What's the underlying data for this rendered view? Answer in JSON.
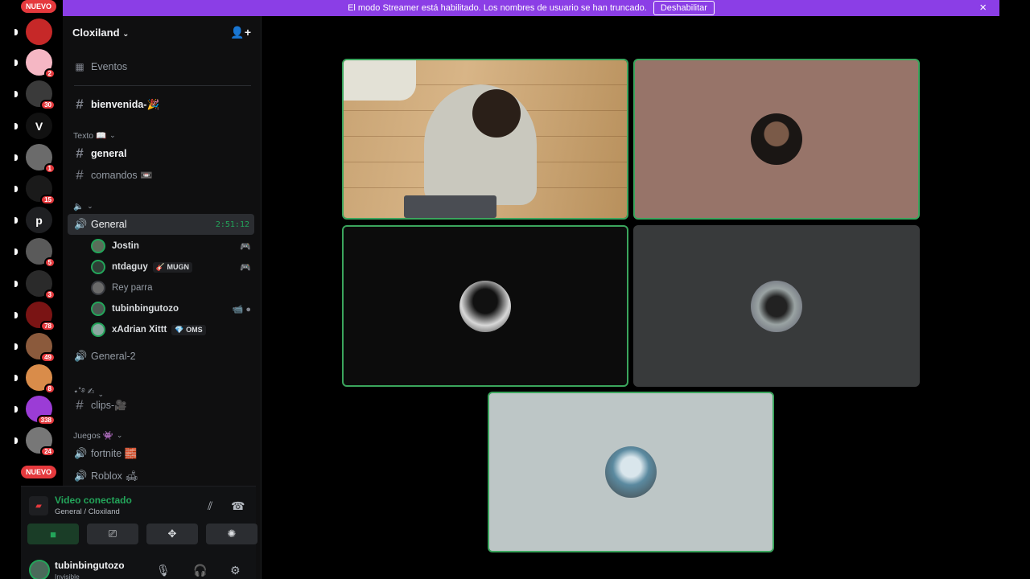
{
  "banner": {
    "message": "El modo Streamer está habilitado. Los nombres de usuario se han truncado.",
    "button": "Deshabilitar",
    "close_icon": "×"
  },
  "rail": {
    "new_label": "NUEVO",
    "servers": [
      {
        "letter": "",
        "color": "#c62828",
        "badge": ""
      },
      {
        "letter": "",
        "color": "#f5b7c4",
        "badge": "2"
      },
      {
        "letter": "",
        "color": "#3a3a3a",
        "badge": "30"
      },
      {
        "letter": "V",
        "color": "#111111",
        "badge": ""
      },
      {
        "letter": "",
        "color": "#6b6b6b",
        "badge": "1"
      },
      {
        "letter": "",
        "color": "#1a1a1a",
        "badge": "15"
      },
      {
        "letter": "p",
        "color": "#1e1f22",
        "badge": ""
      },
      {
        "letter": "",
        "color": "#5a5a5a",
        "badge": "5"
      },
      {
        "letter": "",
        "color": "#2a2a2a",
        "badge": "3"
      },
      {
        "letter": "",
        "color": "#7a1414",
        "badge": "78"
      },
      {
        "letter": "",
        "color": "#8b5a3c",
        "badge": "49"
      },
      {
        "letter": "",
        "color": "#d98c4a",
        "badge": "8"
      },
      {
        "letter": "",
        "color": "#9b3cd6",
        "badge": "338"
      },
      {
        "letter": "",
        "color": "#777777",
        "badge": "24"
      }
    ]
  },
  "sidebar": {
    "server_name": "Cloxiland",
    "events": "Eventos",
    "welcome": "bienvenida-🎉",
    "cat_text": "Texto 📖",
    "general_text": "general",
    "commands": "comandos 📼",
    "cat_voice": "🔈",
    "voice_general": "General",
    "timer": "2:51:12",
    "users": [
      {
        "name": "Jostin",
        "tag": "",
        "right": "🎮",
        "dim": false
      },
      {
        "name": "ntdaguy",
        "tag": "🎸 MUGN",
        "right": "🎮",
        "dim": false
      },
      {
        "name": "Rey parra",
        "tag": "",
        "right": "",
        "dim": true
      },
      {
        "name": "tubinbingutozo",
        "tag": "",
        "right": "📹 ●",
        "dim": false
      },
      {
        "name": "xAdrian Xittt",
        "tag": "💎 OMS",
        "right": "",
        "dim": false
      }
    ],
    "voice_general2": "General-2",
    "cat_clips": "⋆˚࿔ ✍",
    "clips": "clips-🎥",
    "cat_games": "Juegos 👾",
    "fortnite": "fortnite 🧱",
    "roblox": "Roblox 🛋"
  },
  "voice": {
    "title": "Video conectado",
    "sub": "General / Cloxiland"
  },
  "user_panel": {
    "name": "tubinbingutozo",
    "status": "Invisible"
  },
  "colors": {
    "accent_green": "#23a55a",
    "banner": "#8b3ee6",
    "badge": "#e5393d"
  }
}
